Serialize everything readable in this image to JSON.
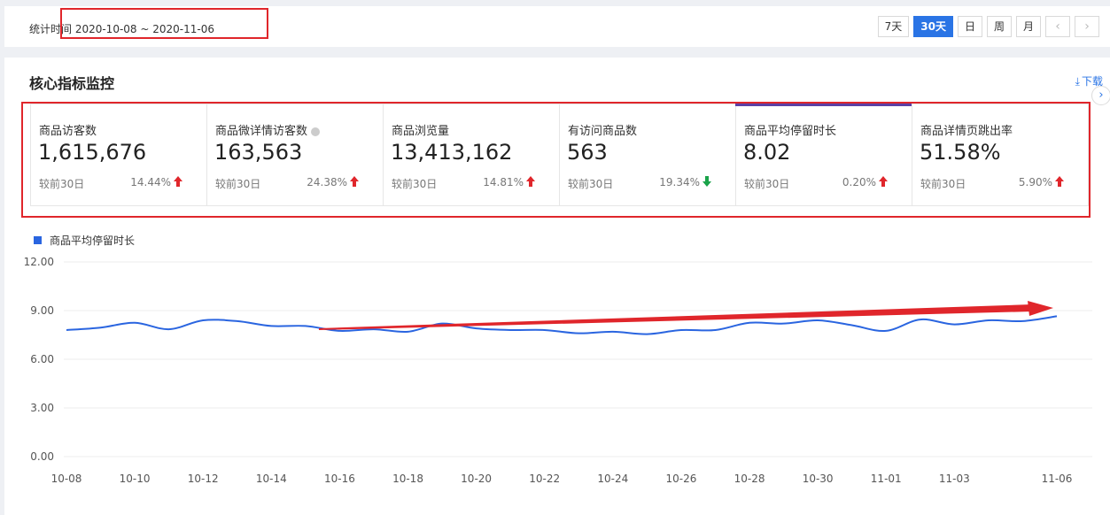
{
  "header": {
    "range_label": "统计时间 2020-10-08 ~ 2020-11-06",
    "buttons": [
      {
        "label": "7天",
        "active": false
      },
      {
        "label": "30天",
        "active": true
      },
      {
        "label": "日",
        "active": false
      },
      {
        "label": "周",
        "active": false
      },
      {
        "label": "月",
        "active": false
      }
    ],
    "prev_icon": "chevron-left-icon",
    "next_icon": "chevron-right-icon"
  },
  "panel": {
    "title": "核心指标监控",
    "download_label": "下载",
    "download_icon": "download-icon"
  },
  "metrics": [
    {
      "name": "商品访客数",
      "value": "1,615,676",
      "compare_label": "较前30日",
      "change": "14.44%",
      "trend": "up"
    },
    {
      "name": "商品微详情访客数",
      "value": "163,563",
      "compare_label": "较前30日",
      "change": "24.38%",
      "trend": "up",
      "info_icon": "info-icon"
    },
    {
      "name": "商品浏览量",
      "value": "13,413,162",
      "compare_label": "较前30日",
      "change": "14.81%",
      "trend": "up"
    },
    {
      "name": "有访问商品数",
      "value": "563",
      "compare_label": "较前30日",
      "change": "19.34%",
      "trend": "down"
    },
    {
      "name": "商品平均停留时长",
      "value": "8.02",
      "compare_label": "较前30日",
      "change": "0.20%",
      "trend": "up",
      "selected": true
    },
    {
      "name": "商品详情页跳出率",
      "value": "51.58%",
      "compare_label": "较前30日",
      "change": "5.90%",
      "trend": "up"
    }
  ],
  "colors": {
    "accent": "#2a74e5",
    "up": "#e0262b",
    "down": "#1aa34a",
    "series": "#2a65e0",
    "annotation": "#e0262b"
  },
  "chart_data": {
    "type": "line",
    "legend": "商品平均停留时长",
    "x_labels": [
      "10-08",
      "10-10",
      "10-12",
      "10-14",
      "10-16",
      "10-18",
      "10-20",
      "10-22",
      "10-24",
      "10-26",
      "10-28",
      "10-30",
      "11-01",
      "11-03",
      "11-06"
    ],
    "x": [
      "10-08",
      "10-09",
      "10-10",
      "10-11",
      "10-12",
      "10-13",
      "10-14",
      "10-15",
      "10-16",
      "10-17",
      "10-18",
      "10-19",
      "10-20",
      "10-21",
      "10-22",
      "10-23",
      "10-24",
      "10-25",
      "10-26",
      "10-27",
      "10-28",
      "10-29",
      "10-30",
      "10-31",
      "11-01",
      "11-02",
      "11-03",
      "11-04",
      "11-05",
      "11-06"
    ],
    "series": [
      {
        "name": "商品平均停留时长",
        "values": [
          7.8,
          7.95,
          8.25,
          7.85,
          8.4,
          8.35,
          8.05,
          8.05,
          7.75,
          7.85,
          7.7,
          8.2,
          7.9,
          7.8,
          7.8,
          7.6,
          7.7,
          7.55,
          7.8,
          7.8,
          8.25,
          8.2,
          8.4,
          8.1,
          7.75,
          8.45,
          8.15,
          8.4,
          8.35,
          8.65
        ]
      }
    ],
    "ylim": [
      0,
      12
    ],
    "yticks": [
      "0.00",
      "3.00",
      "6.00",
      "9.00",
      "12.00"
    ],
    "grid": true,
    "legend_position": "top-left"
  }
}
